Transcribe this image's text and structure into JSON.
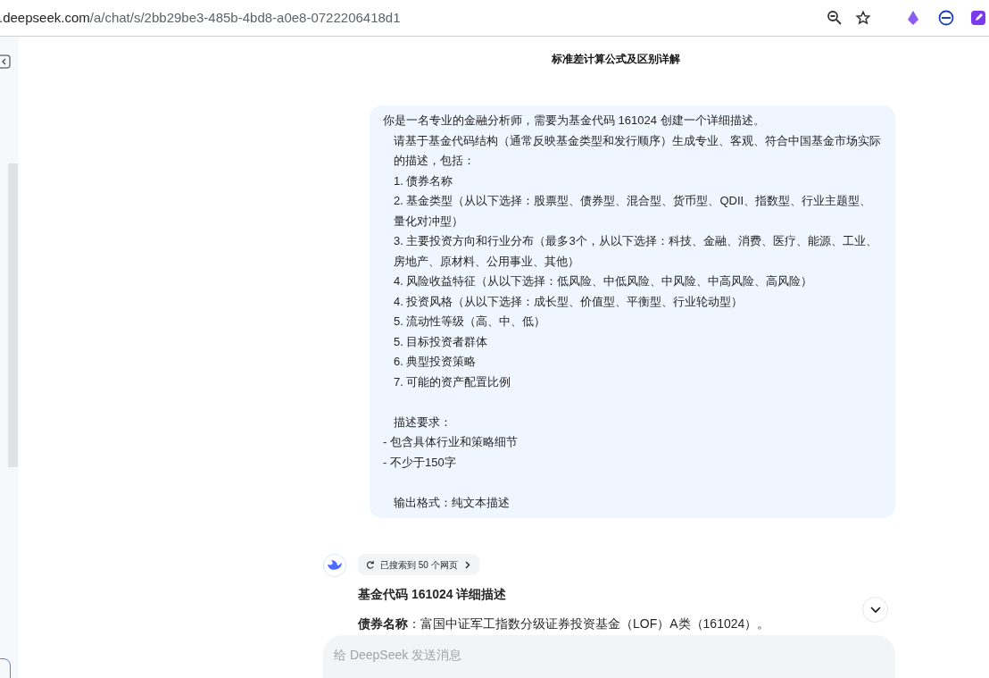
{
  "address_bar": {
    "host": ".deepseek.com",
    "path": "/a/chat/s/2bb29be3-485b-4bd8-a0e8-0722206418d1"
  },
  "chat": {
    "title": "标准差计算公式及区别详解",
    "user_message": [
      {
        "text": "你是一名专业的金融分析师，需要为基金代码 161024 创建一个详细描述。",
        "indented": false,
        "space_before": false
      },
      {
        "text": "请基于基金代码结构（通常反映基金类型和发行顺序）生成专业、客观、符合中国基金市场实际的描述，包括：",
        "indented": true,
        "space_before": false
      },
      {
        "text": "1. 债券名称",
        "indented": true,
        "space_before": false
      },
      {
        "text": "2. 基金类型（从以下选择：股票型、债券型、混合型、货币型、QDII、指数型、行业主题型、量化对冲型）",
        "indented": true,
        "space_before": false
      },
      {
        "text": "3. 主要投资方向和行业分布（最多3个，从以下选择：科技、金融、消费、医疗、能源、工业、房地产、原材料、公用事业、其他）",
        "indented": true,
        "space_before": false
      },
      {
        "text": "4. 风险收益特征（从以下选择：低风险、中低风险、中风险、中高风险、高风险）",
        "indented": true,
        "space_before": false
      },
      {
        "text": "4. 投资风格（从以下选择：成长型、价值型、平衡型、行业轮动型）",
        "indented": true,
        "space_before": false
      },
      {
        "text": "5. 流动性等级（高、中、低）",
        "indented": true,
        "space_before": false
      },
      {
        "text": "5. 目标投资者群体",
        "indented": true,
        "space_before": false
      },
      {
        "text": "6. 典型投资策略",
        "indented": true,
        "space_before": false
      },
      {
        "text": "7. 可能的资产配置比例",
        "indented": true,
        "space_before": false
      },
      {
        "text": "描述要求：",
        "indented": true,
        "space_before": true
      },
      {
        "text": "- 包含具体行业和策略细节",
        "indented": false,
        "space_before": false
      },
      {
        "text": "- 不少于150字",
        "indented": false,
        "space_before": false
      },
      {
        "text": "输出格式：纯文本描述",
        "indented": true,
        "space_before": true
      }
    ],
    "search_chip": "已搜索到 50 个网页",
    "reply_heading": "基金代码 161024 详细描述",
    "reply_paragraph": "**债券名称**：富国中证军工指数分级证券投资基金（LOF）A类（161024）。",
    "input": {
      "placeholder": "给 DeepSeek 发送消息"
    }
  }
}
